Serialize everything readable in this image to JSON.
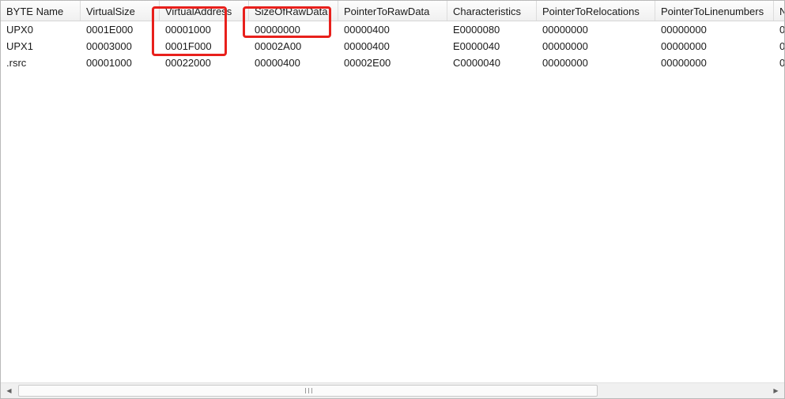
{
  "table": {
    "columns": [
      "BYTE Name",
      "VirtualSize",
      "VirtualAddress",
      "SizeOfRawData",
      "PointerToRawData",
      "Characteristics",
      "PointerToRelocations",
      "PointerToLinenumbers",
      "N"
    ],
    "rows": [
      [
        "UPX0",
        "0001E000",
        "00001000",
        "00000000",
        "00000400",
        "E0000080",
        "00000000",
        "00000000",
        "0"
      ],
      [
        "UPX1",
        "00003000",
        "0001F000",
        "00002A00",
        "00000400",
        "E0000040",
        "00000000",
        "00000000",
        "0"
      ],
      [
        ".rsrc",
        "00001000",
        "00022000",
        "00000400",
        "00002E00",
        "C0000040",
        "00000000",
        "00000000",
        "0"
      ]
    ]
  },
  "scrollbar": {
    "left_arrow_icon": "arrow-left-icon",
    "right_arrow_icon": "arrow-right-icon"
  },
  "annotation": {
    "color": "#e8201c"
  }
}
